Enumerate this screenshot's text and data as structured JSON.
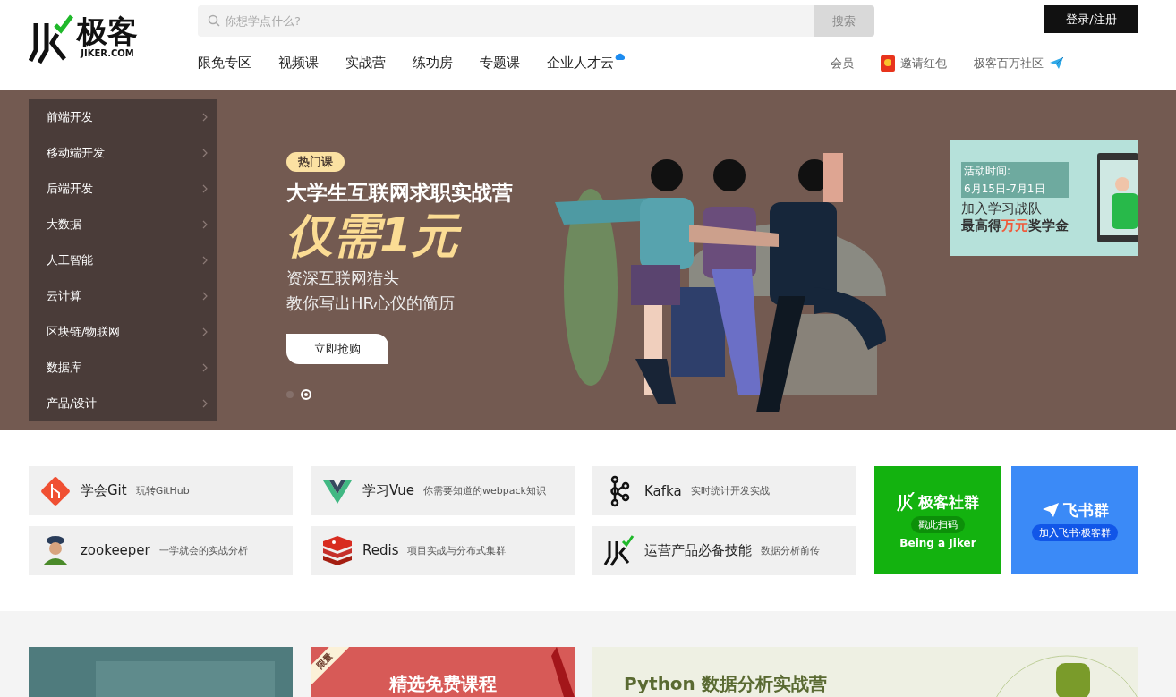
{
  "header": {
    "logo": {
      "text": "极客",
      "subtext": "JIKER.COM"
    },
    "search": {
      "placeholder": "你想学点什么?",
      "button": "搜索"
    },
    "nav": [
      {
        "label": "限免专区",
        "badge": false
      },
      {
        "label": "视频课",
        "badge": false
      },
      {
        "label": "实战营",
        "badge": false
      },
      {
        "label": "练功房",
        "badge": false
      },
      {
        "label": "专题课",
        "badge": false
      },
      {
        "label": "企业人才云",
        "badge": true
      }
    ],
    "links": [
      {
        "label": "会员",
        "kind": "text"
      },
      {
        "label": "邀请红包",
        "kind": "redpacket"
      },
      {
        "label": "极客百万社区",
        "kind": "plane"
      }
    ],
    "login": "登录/注册"
  },
  "banner": {
    "categories": [
      "前端开发",
      "移动端开发",
      "后端开发",
      "大数据",
      "人工智能",
      "云计算",
      "区块链/物联网",
      "数据库",
      "产品/设计"
    ],
    "tag": "热门课",
    "title": "大学生互联网求职实战营",
    "headline": "仅需1元",
    "subtitle": [
      "资深互联网猎头",
      "教你写出HR心仪的简历"
    ],
    "cta": "立即抢购",
    "dots": [
      {
        "selected": false
      },
      {
        "selected": true
      }
    ],
    "ad": {
      "time_label": "活动时间:",
      "time": "6月15日-7月1日",
      "line1": "加入学习战队",
      "line2": "最高得**万元**奖学金"
    }
  },
  "courses": [
    {
      "title": "学会Git",
      "desc": "玩转GitHub",
      "kind": "git"
    },
    {
      "title": "学习Vue",
      "desc": "你需要知道的webpack知识",
      "kind": "vue"
    },
    {
      "title": "Kafka",
      "desc": "实时统计开发实战",
      "kind": "kafka"
    },
    {
      "title": "zookeeper",
      "desc": "一学就会的实战分析",
      "kind": "person"
    },
    {
      "title": "Redis",
      "desc": "项目实战与分布式集群",
      "kind": "redis"
    },
    {
      "title": "运营产品必备技能",
      "desc": "数据分析前传",
      "kind": "logo"
    }
  ],
  "groups": [
    {
      "kind": "jiker",
      "title": "极客社群",
      "pill": "戳此扫码",
      "caption": "Being a Jiker"
    },
    {
      "kind": "feishu",
      "title": "飞书群",
      "pill": "加入飞书·极客群"
    }
  ],
  "promos": [
    {
      "kind": "teal"
    },
    {
      "kind": "red",
      "ribbon": "限量",
      "title": "精选免费课程"
    },
    {
      "kind": "light",
      "title": "Python 数据分析实战营"
    }
  ]
}
